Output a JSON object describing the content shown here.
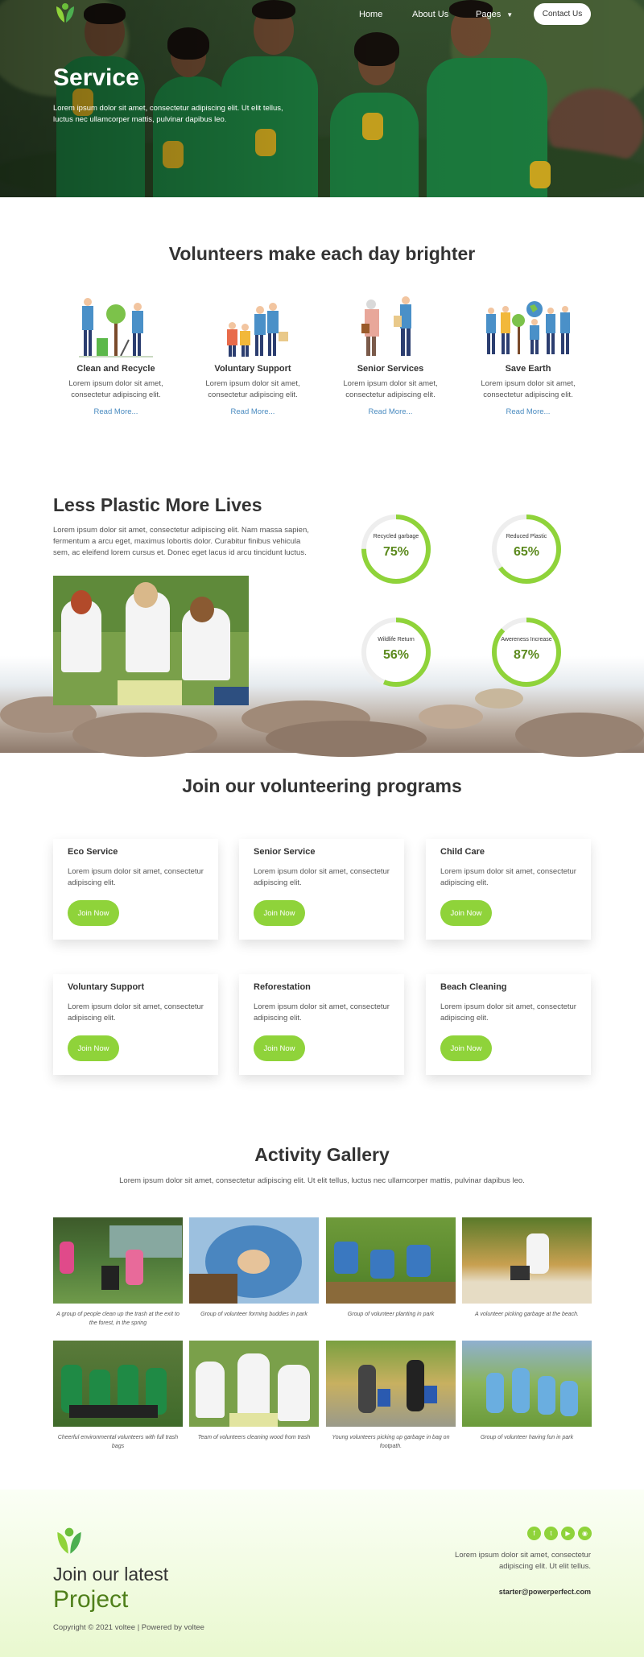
{
  "nav": {
    "home": "Home",
    "about": "About Us",
    "pages": "Pages",
    "contact": "Contact Us"
  },
  "hero": {
    "title": "Service",
    "subtitle": "Lorem ipsum dolor sit amet, consectetur adipiscing elit. Ut elit tellus, luctus nec ullamcorper mattis, pulvinar dapibus leo."
  },
  "volunteers": {
    "title": "Volunteers make each day brighter",
    "items": [
      {
        "title": "Clean and Recycle",
        "text": "Lorem ipsum dolor sit amet, consectetur adipiscing elit.",
        "link": "Read More..."
      },
      {
        "title": "Voluntary Support",
        "text": "Lorem ipsum dolor sit amet, consectetur adipiscing elit.",
        "link": "Read More..."
      },
      {
        "title": "Senior Services",
        "text": "Lorem ipsum dolor sit amet, consectetur adipiscing elit.",
        "link": "Read More..."
      },
      {
        "title": "Save Earth",
        "text": "Lorem ipsum dolor sit amet, consectetur adipiscing elit.",
        "link": "Read More..."
      }
    ]
  },
  "plastic": {
    "title": "Less Plastic More Lives",
    "text": "Lorem ipsum dolor sit amet, consectetur adipiscing elit. Nam massa sapien, fermentum a arcu eget, maximus lobortis dolor. Curabitur finibus vehicula sem, ac eleifend lorem cursus et. Donec eget lacus id arcu tincidunt luctus.",
    "stats": [
      {
        "label": "Recycled garbage",
        "value": "75%",
        "fraction": 0.75
      },
      {
        "label": "Reduced Plastic",
        "value": "65%",
        "fraction": 0.65
      },
      {
        "label": "Wildlife Return",
        "value": "56%",
        "fraction": 0.56
      },
      {
        "label": "Awereness Increase",
        "value": "87%",
        "fraction": 0.87
      }
    ]
  },
  "programs": {
    "title": "Join our volunteering programs",
    "items": [
      {
        "title": "Eco Service",
        "text": "Lorem ipsum dolor sit amet, consectetur adipiscing elit.",
        "button": "Join Now"
      },
      {
        "title": "Senior Service",
        "text": "Lorem ipsum dolor sit amet, consectetur adipiscing elit.",
        "button": "Join Now"
      },
      {
        "title": "Child Care",
        "text": "Lorem ipsum dolor sit amet, consectetur adipiscing elit.",
        "button": "Join Now"
      },
      {
        "title": "Voluntary Support",
        "text": "Lorem ipsum dolor sit amet, consectetur adipiscing elit.",
        "button": "Join Now"
      },
      {
        "title": "Reforestation",
        "text": "Lorem ipsum dolor sit amet, consectetur adipiscing elit.",
        "button": "Join Now"
      },
      {
        "title": "Beach Cleaning",
        "text": "Lorem ipsum dolor sit amet, consectetur adipiscing elit.",
        "button": "Join Now"
      }
    ]
  },
  "gallery": {
    "title": "Activity Gallery",
    "subtitle": "Lorem ipsum dolor sit amet, consectetur adipiscing elit. Ut elit tellus, luctus nec ullamcorper mattis, pulvinar dapibus leo.",
    "captions": [
      "A group of people clean up the trash at the exit to the forest, in the spring",
      "Group of volunteer forming buddies in park",
      "Group of volunteer planting in park",
      "A volunteer picking garbage at the beach.",
      "Cheerful environmental volunteers with full trash bags",
      "Team of volunteers cleaning wood from trash",
      "Young volunteers picking up garbage in bag on footpath.",
      "Group of volunteer having fun in park"
    ]
  },
  "footer": {
    "join": "Join our latest",
    "project": "Project",
    "text": "Lorem ipsum dolor sit amet, consectetur adipiscing elit. Ut elit tellus.",
    "email": "starter@powerperfect.com",
    "copyright": "Copyright © 2021 voltee | Powered by voltee"
  },
  "colors": {
    "accent": "#8fd33a",
    "accent_dark": "#4f7f1a",
    "link": "#4a8bc0"
  }
}
